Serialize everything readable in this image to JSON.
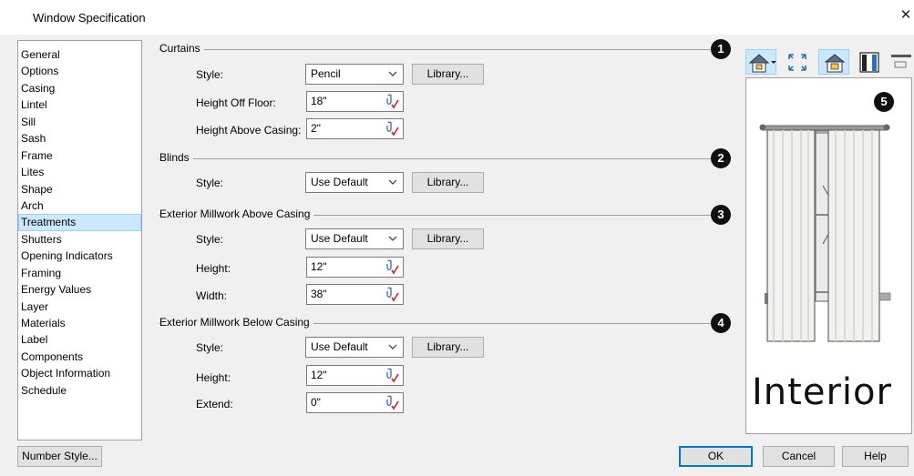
{
  "window": {
    "title": "Window Specification"
  },
  "nav": {
    "items": [
      "General",
      "Options",
      "Casing",
      "Lintel",
      "Sill",
      "Sash",
      "Frame",
      "Lites",
      "Shape",
      "Arch",
      "Treatments",
      "Shutters",
      "Opening Indicators",
      "Framing",
      "Energy Values",
      "Layer",
      "Materials",
      "Label",
      "Components",
      "Object Information",
      "Schedule"
    ],
    "selected": "Treatments"
  },
  "curtains": {
    "heading": "Curtains",
    "badge": "1",
    "style_label": "Style:",
    "style_value": "Pencil",
    "library_label": "Library...",
    "height_off_floor_label": "Height Off Floor:",
    "height_off_floor_value": "18\"",
    "height_above_casing_label": "Height Above Casing:",
    "height_above_casing_value": "2\""
  },
  "blinds": {
    "heading": "Blinds",
    "badge": "2",
    "style_label": "Style:",
    "style_value": "Use Default",
    "library_label": "Library..."
  },
  "above": {
    "heading": "Exterior Millwork Above Casing",
    "badge": "3",
    "style_label": "Style:",
    "style_value": "Use Default",
    "library_label": "Library...",
    "height_label": "Height:",
    "height_value": "12\"",
    "width_label": "Width:",
    "width_value": "38\""
  },
  "below": {
    "heading": "Exterior Millwork Below Casing",
    "badge": "4",
    "style_label": "Style:",
    "style_value": "Use Default",
    "library_label": "Library...",
    "height_label": "Height:",
    "height_value": "12\"",
    "extend_label": "Extend:",
    "extend_value": "0\""
  },
  "preview": {
    "badge": "5",
    "label": "Interior"
  },
  "footer": {
    "number_style": "Number Style...",
    "ok": "OK",
    "cancel": "Cancel",
    "help": "Help"
  },
  "icons": [
    "home-view-icon",
    "fit-view-icon",
    "treatment-view-icon",
    "door-view-icon",
    "reset-view-icon"
  ]
}
